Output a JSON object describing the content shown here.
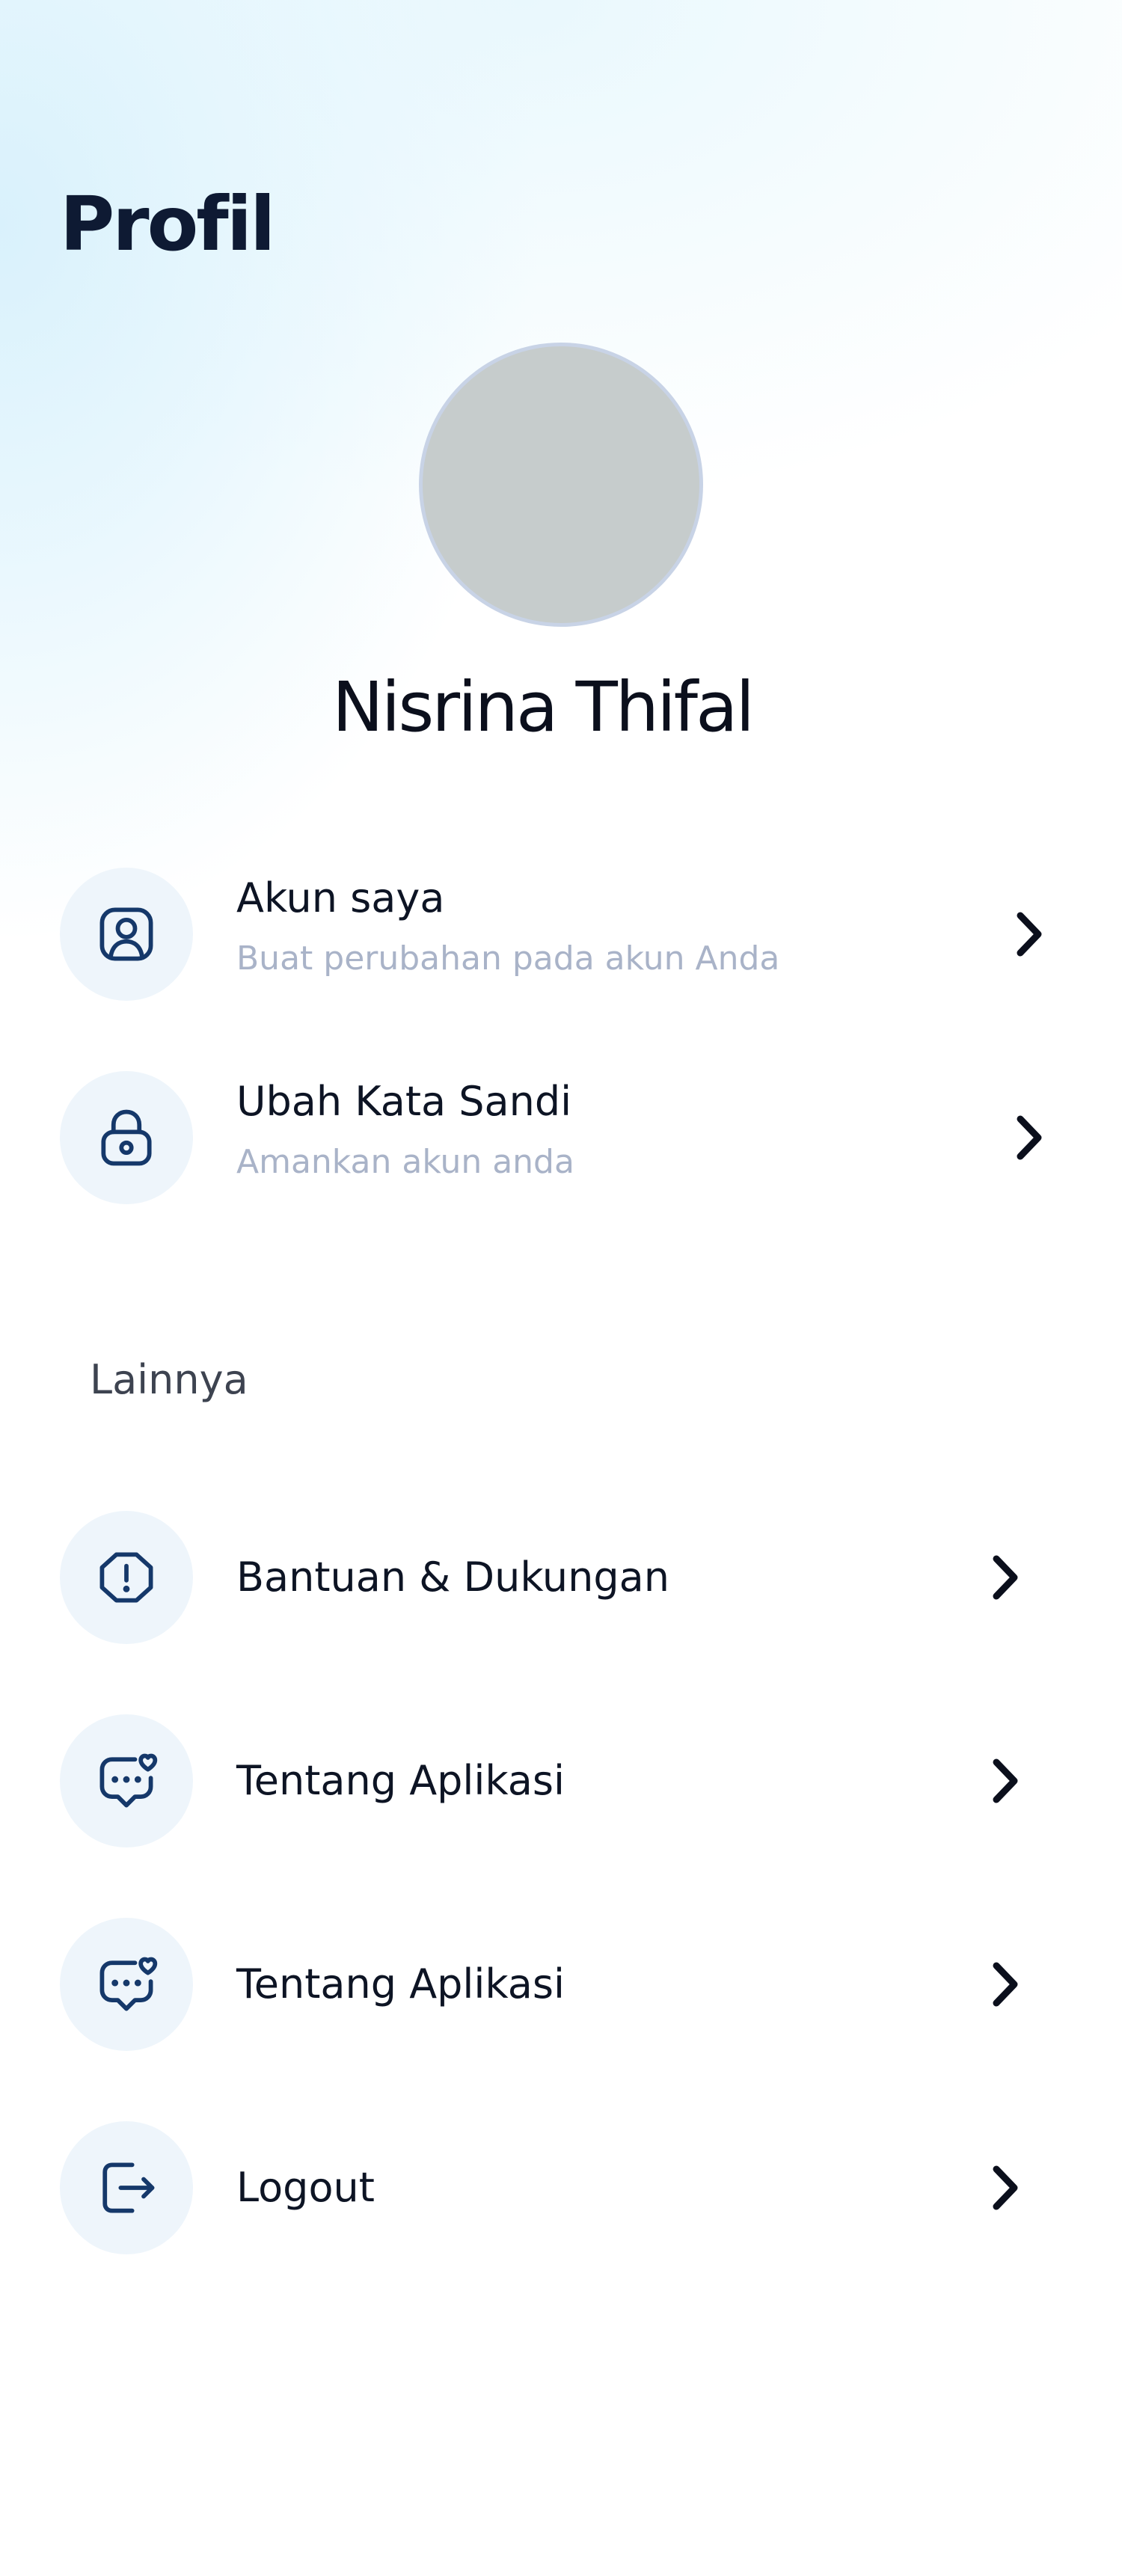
{
  "header": {
    "title": "Profil"
  },
  "profile": {
    "name": "Nisrina Thifal"
  },
  "account_menu": [
    {
      "title": "Akun saya",
      "subtitle": "Buat perubahan pada akun Anda",
      "icon": "user-profile-icon"
    },
    {
      "title": "Ubah Kata Sandi",
      "subtitle": "Amankan akun anda",
      "icon": "lock-icon"
    }
  ],
  "other_section": {
    "label": "Lainnya",
    "items": [
      {
        "title": "Bantuan & Dukungan",
        "icon": "alert-shield-icon"
      },
      {
        "title": "Tentang Aplikasi",
        "icon": "chat-heart-icon"
      },
      {
        "title": "Tentang Aplikasi",
        "icon": "chat-heart-icon"
      },
      {
        "title": "Logout",
        "icon": "logout-icon"
      }
    ]
  },
  "colors": {
    "icon_stroke": "#15386a",
    "icon_bg": "#eef5fb",
    "subtitle": "#a9b3c8",
    "title": "#0e1a33"
  }
}
